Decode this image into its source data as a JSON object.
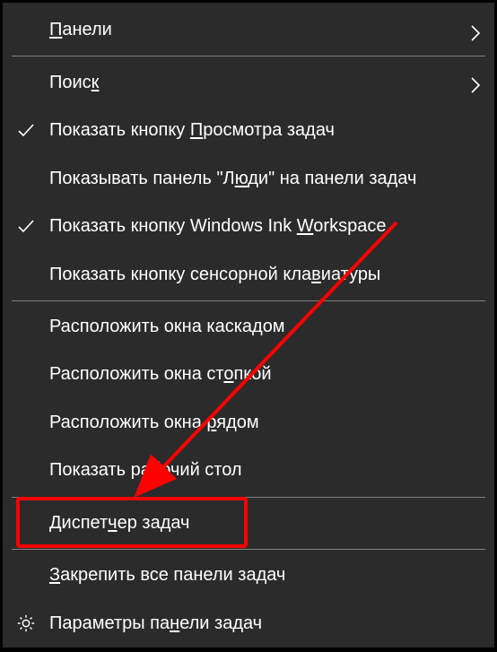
{
  "menu": {
    "panels_pre": "",
    "panels_u": "П",
    "panels_post": "анели",
    "search_pre": "Поис",
    "search_u": "к",
    "search_post": "",
    "taskview_pre": "Показать кнопку ",
    "taskview_u": "П",
    "taskview_post": "росмотра задач",
    "people_pre": "Показывать панель \"Л",
    "people_u": "ю",
    "people_post": "ди\" на панели задач",
    "ink_pre": "Показать кнопку Windows Ink ",
    "ink_u": "W",
    "ink_post": "orkspace",
    "touchkb_pre": "Показать кнопку сенсорной кла",
    "touchkb_u": "в",
    "touchkb_post": "иатуры",
    "cascade_pre": "Расположить окна каска",
    "cascade_u": "д",
    "cascade_post": "ом",
    "stacked_pre": "Расположить окна ст",
    "stacked_u": "о",
    "stacked_post": "пкой",
    "sidebyside_pre": "Расположить окна ",
    "sidebyside_u": "р",
    "sidebyside_post": "ядом",
    "desktop_pre": "Показать ра",
    "desktop_u": "б",
    "desktop_post": "очий стол",
    "taskmgr_pre": "Диспет",
    "taskmgr_u": "ч",
    "taskmgr_post": "ер задач",
    "lock_pre": "",
    "lock_u": "З",
    "lock_post": "акрепить все панели задач",
    "settings_pre": "Параметры па",
    "settings_u": "н",
    "settings_post": "ели задач"
  },
  "annotation": {
    "highlight_target": "task-manager",
    "arrow_color": "#ff0000"
  }
}
